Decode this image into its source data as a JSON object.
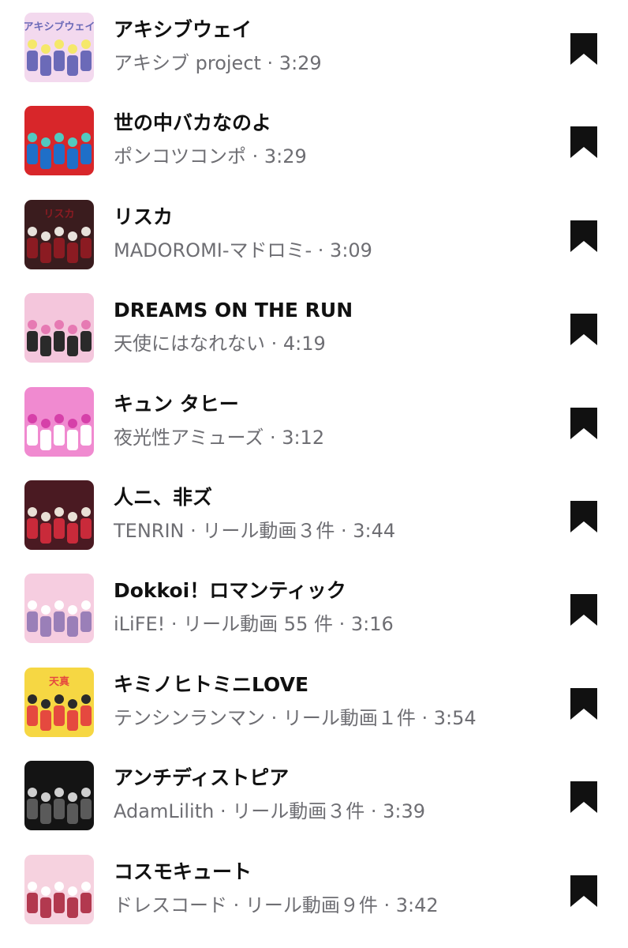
{
  "songs": [
    {
      "title": "アキシブウェイ",
      "subtitle": "アキシブ project · 3:29",
      "art": {
        "bg": "#f3d9ee",
        "accent": "#6b6ab8",
        "detail": "#f5e86a",
        "lettering": "アキシブウェイ"
      }
    },
    {
      "title": "世の中バカなのよ",
      "subtitle": "ポンコツコンポ · 3:29",
      "art": {
        "bg": "#d8262a",
        "accent": "#1f6fc8",
        "detail": "#52c9c0",
        "lettering": ""
      }
    },
    {
      "title": "リスカ",
      "subtitle": "MADOROMI-マドロミ- · 3:09",
      "art": {
        "bg": "#3a1c1e",
        "accent": "#8b1b22",
        "detail": "#e8e2dc",
        "lettering": "リスカ"
      }
    },
    {
      "title": "DREAMS ON THE RUN",
      "subtitle": "天使にはなれない · 4:19",
      "art": {
        "bg": "#f4c6dc",
        "accent": "#2a2a2a",
        "detail": "#e67ab3",
        "lettering": ""
      }
    },
    {
      "title": "キュン タヒー",
      "subtitle": "夜光性アミューズ · 3:12",
      "art": {
        "bg": "#f08ad0",
        "accent": "#ffffff",
        "detail": "#d640a9",
        "lettering": ""
      }
    },
    {
      "title": "人ニ、非ズ",
      "subtitle": "TENRIN · リール動画３件 · 3:44",
      "art": {
        "bg": "#4a1a22",
        "accent": "#c92a3a",
        "detail": "#e9e0d6",
        "lettering": ""
      }
    },
    {
      "title": "Dokkoi！ロマンティック",
      "subtitle": "iLiFE! · リール動画 55 件 · 3:16",
      "art": {
        "bg": "#f6cde0",
        "accent": "#9a7fb8",
        "detail": "#ffffff",
        "lettering": ""
      }
    },
    {
      "title": "キミノヒトミニLOVE",
      "subtitle": "テンシンランマン · リール動画１件 · 3:54",
      "art": {
        "bg": "#f6d743",
        "accent": "#e5493f",
        "detail": "#2a2a2a",
        "lettering": "天真"
      }
    },
    {
      "title": "アンチディストピア",
      "subtitle": "AdamLilith · リール動画３件 · 3:39",
      "art": {
        "bg": "#141414",
        "accent": "#5a5a5a",
        "detail": "#cfcfcf",
        "lettering": ""
      }
    },
    {
      "title": "コスモキュート",
      "subtitle": "ドレスコード · リール動画９件 · 3:42",
      "art": {
        "bg": "#f6d2df",
        "accent": "#b2394f",
        "detail": "#ffffff",
        "lettering": ""
      }
    }
  ],
  "icons": {
    "save": "bookmark-icon"
  },
  "colors": {
    "title": "#111111",
    "subtitle": "#6e6e73",
    "icon": "#111111",
    "background": "#ffffff"
  }
}
